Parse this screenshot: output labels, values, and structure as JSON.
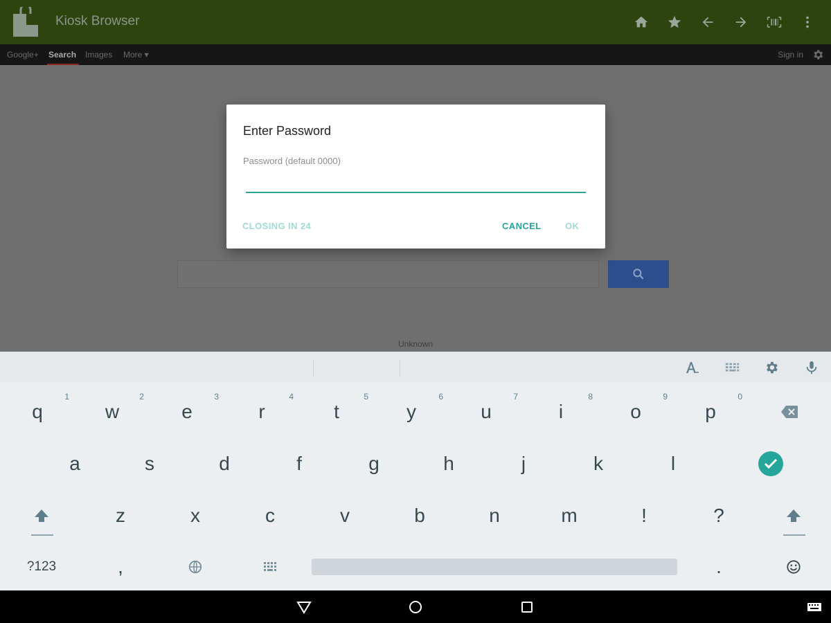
{
  "appbar": {
    "title": "Kiosk Browser",
    "icons": [
      "home-icon",
      "star-icon",
      "back-arrow-icon",
      "forward-arrow-icon",
      "barcode-scanner-icon",
      "more-vert-icon"
    ]
  },
  "gbar": {
    "links": [
      "Google+",
      "Search",
      "Images",
      "More ▾"
    ],
    "active": "Search",
    "signin": "Sign in"
  },
  "web": {
    "footer_label": "Unknown"
  },
  "dialog": {
    "title": "Enter Password",
    "field_label": "Password (default 0000)",
    "field_value": "",
    "closing": "CLOSING IN 24",
    "cancel": "CANCEL",
    "ok": "OK"
  },
  "keyboard": {
    "row1": [
      {
        "key": "q",
        "hint": "1"
      },
      {
        "key": "w",
        "hint": "2"
      },
      {
        "key": "e",
        "hint": "3"
      },
      {
        "key": "r",
        "hint": "4"
      },
      {
        "key": "t",
        "hint": "5"
      },
      {
        "key": "y",
        "hint": "6"
      },
      {
        "key": "u",
        "hint": "7"
      },
      {
        "key": "i",
        "hint": "8"
      },
      {
        "key": "o",
        "hint": "9"
      },
      {
        "key": "p",
        "hint": "0"
      }
    ],
    "row2": [
      "a",
      "s",
      "d",
      "f",
      "g",
      "h",
      "j",
      "k",
      "l"
    ],
    "row3": [
      "z",
      "x",
      "c",
      "v",
      "b",
      "n",
      "m",
      "!",
      "?"
    ],
    "row4": {
      "symbols": "?123",
      "comma": ",",
      "period": "."
    },
    "toolbar_icons": [
      "text-style-icon",
      "keyboard-layout-icon",
      "settings-icon",
      "mic-icon"
    ]
  },
  "colors": {
    "appbar": "#2d440f",
    "accent": "#26a69a",
    "search_button": "#2d4e8c"
  }
}
